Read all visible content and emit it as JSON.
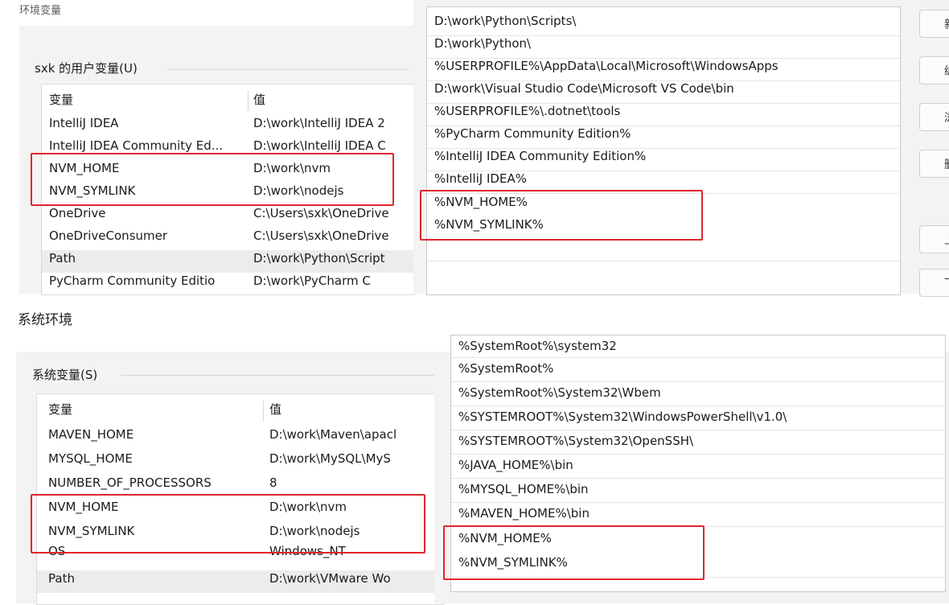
{
  "top_caption": "环境变量",
  "section_heading": "系统环境",
  "user_group": {
    "label": "sxk 的用户变量(U)",
    "headers": {
      "variable": "变量",
      "value": "值"
    },
    "rows": [
      {
        "name": "IntelliJ IDEA",
        "value": "D:\\work\\IntelliJ IDEA 2"
      },
      {
        "name": "IntelliJ IDEA Community Ed...",
        "value": "D:\\work\\IntelliJ IDEA C"
      },
      {
        "name": "NVM_HOME",
        "value": "D:\\work\\nvm"
      },
      {
        "name": "NVM_SYMLINK",
        "value": "D:\\work\\nodejs"
      },
      {
        "name": "OneDrive",
        "value": "C:\\Users\\sxk\\OneDrive"
      },
      {
        "name": "OneDriveConsumer",
        "value": "C:\\Users\\sxk\\OneDrive"
      },
      {
        "name": "Path",
        "value": "D:\\work\\Python\\Script"
      },
      {
        "name": "PyCharm Community Editio",
        "value": "D:\\work\\PyCharm C"
      }
    ]
  },
  "user_path_list": [
    "D:\\work\\Python\\Scripts\\",
    "D:\\work\\Python\\",
    "%USERPROFILE%\\AppData\\Local\\Microsoft\\WindowsApps",
    "D:\\work\\Visual Studio Code\\Microsoft VS Code\\bin",
    "%USERPROFILE%\\.dotnet\\tools",
    "%PyCharm Community Edition%",
    "%IntelliJ IDEA Community Edition%",
    "%IntelliJ IDEA%",
    "%NVM_HOME%",
    "%NVM_SYMLINK%"
  ],
  "user_side_buttons": [
    "新",
    "编",
    "浏",
    "删",
    "上",
    "下"
  ],
  "system_group": {
    "label": "系统变量(S)",
    "headers": {
      "variable": "变量",
      "value": "值"
    },
    "rows": [
      {
        "name": "MAVEN_HOME",
        "value": "D:\\work\\Maven\\apacl"
      },
      {
        "name": "MYSQL_HOME",
        "value": "D:\\work\\MySQL\\MyS"
      },
      {
        "name": "NUMBER_OF_PROCESSORS",
        "value": "8"
      },
      {
        "name": "NVM_HOME",
        "value": "D:\\work\\nvm"
      },
      {
        "name": "NVM_SYMLINK",
        "value": "D:\\work\\nodejs"
      },
      {
        "name": "OS",
        "value": "Windows_NT"
      },
      {
        "name": "Path",
        "value": "D:\\work\\VMware Wo"
      }
    ]
  },
  "system_path_list": [
    "%SystemRoot%\\system32",
    "%SystemRoot%",
    "%SystemRoot%\\System32\\Wbem",
    "%SYSTEMROOT%\\System32\\WindowsPowerShell\\v1.0\\",
    "%SYSTEMROOT%\\System32\\OpenSSH\\",
    "%JAVA_HOME%\\bin",
    "%MYSQL_HOME%\\bin",
    "%MAVEN_HOME%\\bin",
    "%NVM_HOME%",
    "%NVM_SYMLINK%"
  ],
  "highlight_color": "#e0262d"
}
